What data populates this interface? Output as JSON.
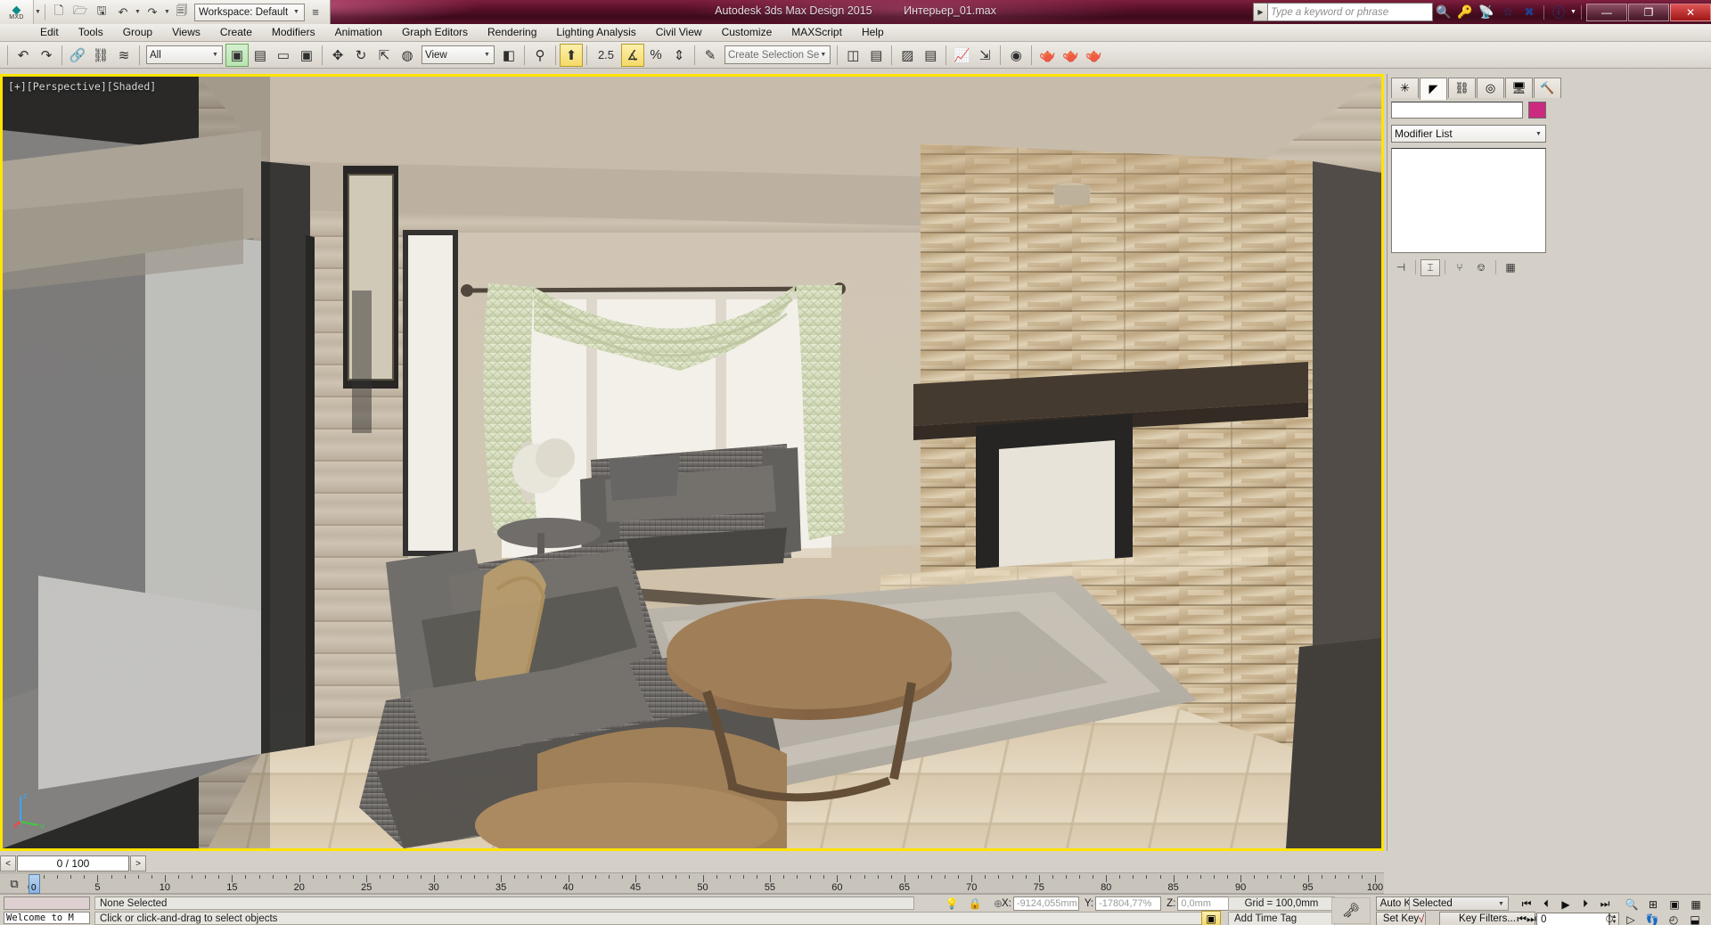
{
  "window": {
    "app_title": "Autodesk 3ds Max Design 2015",
    "file_name": "Интерьер_01.max",
    "minimize_label": "—",
    "maximize_label": "❐",
    "close_label": "✕"
  },
  "quick_access": {
    "logo_text": "MXD",
    "items": [
      {
        "name": "new-file-icon",
        "glyph": "🗋"
      },
      {
        "name": "open-file-icon",
        "glyph": "🗁"
      },
      {
        "name": "save-file-icon",
        "glyph": "🖫"
      },
      {
        "name": "undo-icon",
        "glyph": "↶"
      },
      {
        "name": "redo-icon",
        "glyph": "↷"
      },
      {
        "name": "project-folder-icon",
        "glyph": "🗐"
      }
    ],
    "workspace_label": "Workspace: Default"
  },
  "search": {
    "placeholder": "Type a keyword or phrase",
    "value": ""
  },
  "info_center": [
    {
      "name": "search-icon",
      "glyph": "🔍"
    },
    {
      "name": "key-icon",
      "glyph": "🔑"
    },
    {
      "name": "subscription-icon",
      "glyph": "📡"
    },
    {
      "name": "favorites-star-icon",
      "glyph": "☆"
    },
    {
      "name": "exchange-icon",
      "glyph": "✖"
    },
    {
      "name": "help-icon",
      "glyph": "?"
    }
  ],
  "menu": {
    "items": [
      "Edit",
      "Tools",
      "Group",
      "Views",
      "Create",
      "Modifiers",
      "Animation",
      "Graph Editors",
      "Rendering",
      "Lighting Analysis",
      "Civil View",
      "Customize",
      "MAXScript",
      "Help"
    ]
  },
  "toolbar": {
    "undo_icon": "↶",
    "redo_icon": "↷",
    "select_link_icon": "🔗",
    "unlink_icon": "⛓",
    "bind_space_warp_icon": "≋",
    "selection_filter": "All",
    "select_object_icon": "▣",
    "select_by_name_icon": "▤",
    "select_region_icon": "▭",
    "window_crossing_icon": "▣",
    "select_move_icon": "✥",
    "select_rotate_icon": "↻",
    "select_scale_icon": "⇱",
    "placement_icon": "◍",
    "reference_coord": "View",
    "pivot_icon": "◧",
    "named_sel_icon": "⚲",
    "snap_toggle_icon": "⬆",
    "angle_snap_value": "2.5",
    "angle_snap_icon": "∡",
    "percent_snap_icon": "%",
    "spinner_snap_icon": "⇕",
    "edit_named_sel_icon": "✎",
    "selection_set": "Create Selection Se",
    "mirror_icon": "◫",
    "align_icon": "▤",
    "layer_manager_icon": "▨",
    "toggle_scene_explorer_icon": "▤",
    "curve_editor_icon": "📈",
    "schematic_view_icon": "⇲",
    "material_editor_icon": "◉",
    "render_setup_icon": "🫖",
    "render_frame_icon": "🫖",
    "render_production_icon": "🫖"
  },
  "viewport": {
    "label": "[+][Perspective][Shaded]",
    "axis_labels": {
      "x": "x",
      "y": "y",
      "z": "z"
    },
    "scene_description": "Rendered interior living room with stone fireplace, sofas, armchairs, coffee table, curtained window and tiled floor"
  },
  "command_panel": {
    "tabs": [
      {
        "name": "create-tab",
        "glyph": "✳",
        "active": false
      },
      {
        "name": "modify-tab",
        "glyph": "◤",
        "active": true
      },
      {
        "name": "hierarchy-tab",
        "glyph": "⛓",
        "active": false
      },
      {
        "name": "motion-tab",
        "glyph": "◎",
        "active": false
      },
      {
        "name": "display-tab",
        "glyph": "🖥",
        "active": false
      },
      {
        "name": "utilities-tab",
        "glyph": "🔨",
        "active": false
      }
    ],
    "object_name": "",
    "object_color": "#cc2a7f",
    "modifier_list_label": "Modifier List",
    "stack_items": [],
    "stack_tools": [
      {
        "name": "pin-stack-icon",
        "glyph": "⊣"
      },
      {
        "name": "show-end-result-icon",
        "glyph": "⌶"
      },
      {
        "name": "make-unique-icon",
        "glyph": "⑂"
      },
      {
        "name": "remove-modifier-icon",
        "glyph": "⎊"
      },
      {
        "name": "configure-modifier-sets-icon",
        "glyph": "▦"
      }
    ]
  },
  "timeline": {
    "current_frame_display": "0 / 100",
    "prev_frame_label": "<",
    "next_frame_label": ">",
    "start": 0,
    "end": 100,
    "tick_step": 5,
    "current_frame": 0,
    "set_key_mode_icon": "⧉"
  },
  "status": {
    "mini_listener_text": "",
    "welcome_text": "Welcome to M",
    "selection_text": "None Selected",
    "prompt_text": "Click or click-and-drag to select objects",
    "lock_selection_icon": "🔒",
    "isolate_icon": "💡",
    "absolute_mode_icon": "⊕",
    "coords": {
      "x_label": "X:",
      "x_value": "-9124,055mm",
      "y_label": "Y:",
      "y_value": "-17804,77%",
      "z_label": "Z:",
      "z_value": "0,0mm"
    },
    "grid_text": "Grid = 100,0mm",
    "add_time_tag": "Add Time Tag",
    "key_icon": "🗝"
  },
  "animation": {
    "auto_key_label": "Auto Key",
    "set_key_label": "Set Key",
    "key_mode_selected": "Selected",
    "key_filters_label": "Key Filters...",
    "current_frame_value": "0",
    "curve_icon": "√",
    "playback": [
      {
        "name": "goto-start-button",
        "glyph": "⏮"
      },
      {
        "name": "previous-frame-button",
        "glyph": "⏴"
      },
      {
        "name": "play-animation-button",
        "glyph": "▶"
      },
      {
        "name": "next-frame-button",
        "glyph": "⏵"
      },
      {
        "name": "goto-end-button",
        "glyph": "⏭"
      }
    ],
    "viewport_nav_top": [
      {
        "name": "zoom-icon",
        "glyph": "🔍"
      },
      {
        "name": "zoom-all-icon",
        "glyph": "⊞"
      },
      {
        "name": "zoom-extents-icon",
        "glyph": "▣"
      },
      {
        "name": "zoom-extents-all-icon",
        "glyph": "▦"
      }
    ],
    "viewport_nav_bottom": [
      {
        "name": "field-of-view-icon",
        "glyph": "▧"
      },
      {
        "name": "pan-view-icon",
        "glyph": "▷"
      },
      {
        "name": "walk-through-icon",
        "glyph": "👣"
      },
      {
        "name": "orbit-icon",
        "glyph": "◴"
      },
      {
        "name": "maximize-viewport-icon",
        "glyph": "⬓"
      }
    ],
    "time-config-icon": "⏱"
  }
}
